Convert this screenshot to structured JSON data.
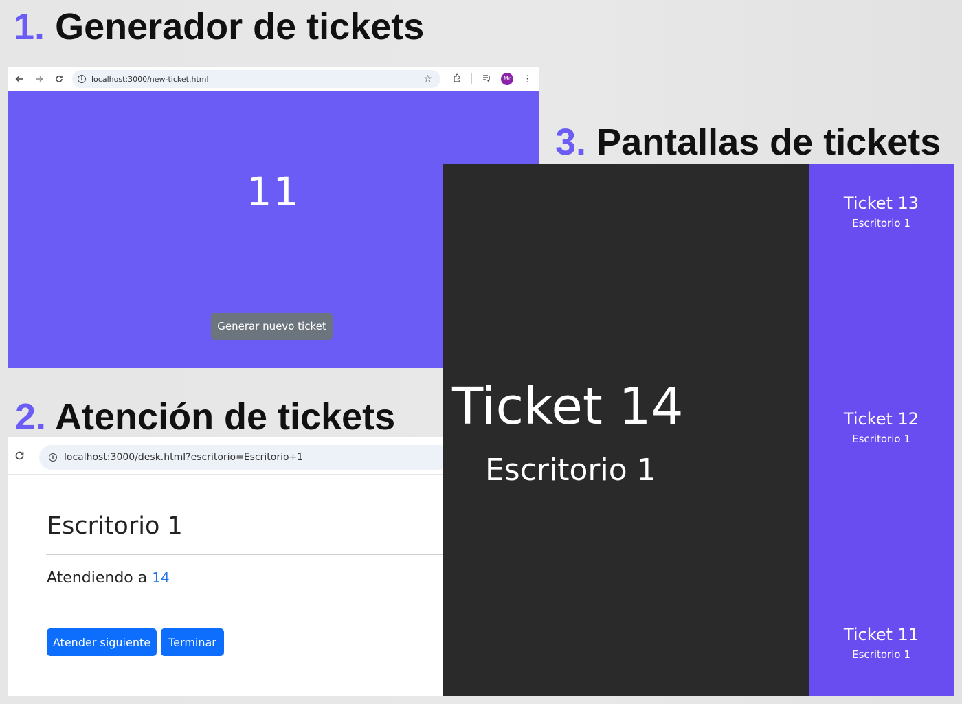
{
  "sections": [
    {
      "number": "1.",
      "title": "Generador de tickets"
    },
    {
      "number": "2.",
      "title": "Atención de tickets"
    },
    {
      "number": "3.",
      "title": "Pantallas de tickets"
    }
  ],
  "generator": {
    "url": "localhost:3000/new-ticket.html",
    "avatar_initials": "Mr",
    "ticket_number": "11",
    "generate_label": "Generar nuevo ticket",
    "colors": {
      "background": "#6a5cf5",
      "button": "#6c757d"
    }
  },
  "desk": {
    "url": "localhost:3000/desk.html?escritorio=Escritorio+1",
    "heading": "Escritorio 1",
    "serving_prefix": "Atendiendo a",
    "serving_number": "14",
    "next_label": "Atender siguiente",
    "finish_label": "Terminar",
    "colors": {
      "button": "#0d6efd",
      "number": "#1f73e8"
    }
  },
  "display": {
    "current": {
      "ticket": "Ticket 14",
      "desk": "Escritorio 1"
    },
    "recent": [
      {
        "ticket": "Ticket 13",
        "desk": "Escritorio 1"
      },
      {
        "ticket": "Ticket 12",
        "desk": "Escritorio 1"
      },
      {
        "ticket": "Ticket 11",
        "desk": "Escritorio 1"
      }
    ],
    "colors": {
      "main": "#2a2a2a",
      "side": "#6a4df0"
    }
  }
}
